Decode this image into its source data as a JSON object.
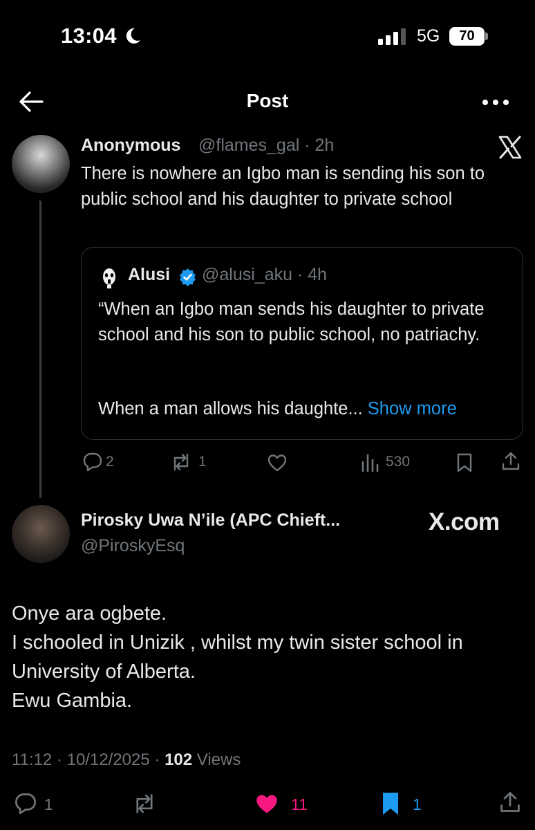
{
  "status_bar": {
    "time": "13:04",
    "network": "5G",
    "battery": "70",
    "icons": [
      "moon-icon",
      "signal-icon"
    ]
  },
  "header": {
    "title": "Post",
    "icons": [
      "back-arrow-icon",
      "more-icon"
    ]
  },
  "tweet1": {
    "name": "Anonymous",
    "handle": "@flames_gal · 2h",
    "text": "There is nowhere an Igbo man is sending his son to public school and his daughter to private school",
    "quote": {
      "name": "Alusi",
      "handle": "@alusi_aku · 4h",
      "text": "“When an Igbo man sends his daughter to private school and his son to public school, no patriachy.",
      "text2": "When a man allows his daughte...",
      "show_more": " Show more"
    },
    "actions": {
      "replies": "2",
      "reposts": "1",
      "views": "530"
    }
  },
  "tweet2": {
    "name": "Pirosky Uwa N’ile (APC Chieft...",
    "handle": "@PiroskyEsq",
    "watermark": "X.com",
    "lines": [
      "Onye ara ogbete.",
      "I schooled in Unizik , whilst my twin sister school in University of Alberta.",
      "Ewu Gambia."
    ],
    "timestamp": "11:12 · 10/12/2025 · ",
    "views_count": "102",
    "views_label": " Views",
    "actions": {
      "replies": "1",
      "likes": "11",
      "bookmarks": "1"
    }
  },
  "colors": {
    "background": "#000000",
    "text": "#e7e9ea",
    "muted": "#71767b",
    "link": "#1d9bf0",
    "like": "#f91880",
    "verified": "#1d9bf0"
  }
}
